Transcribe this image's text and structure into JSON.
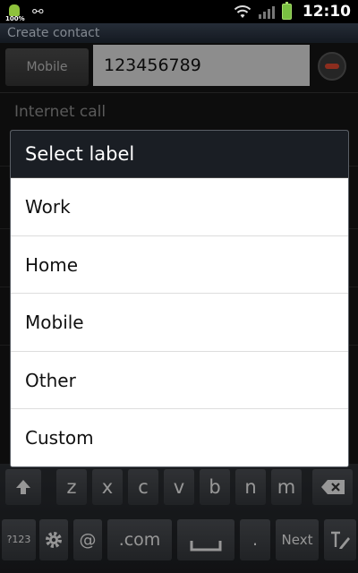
{
  "status_bar": {
    "battery_percent_small": "100%",
    "time": "12:10",
    "icons": [
      "android-icon",
      "usb-icon",
      "wifi-icon",
      "signal-icon",
      "battery-icon"
    ]
  },
  "title_bar": {
    "title": "Create contact"
  },
  "background_form": {
    "phone_label": "Mobile",
    "phone_value": "123456789",
    "section_header": "Internet call"
  },
  "dialog": {
    "title": "Select label",
    "items": [
      "Work",
      "Home",
      "Mobile",
      "Other",
      "Custom"
    ]
  },
  "keyboard": {
    "row1": [
      "z",
      "x",
      "c",
      "v",
      "b",
      "n",
      "m"
    ],
    "row2": {
      "symbols": "?123",
      "at": "@",
      "dotcom": ".com",
      "period": ".",
      "next": "Next"
    },
    "icons": [
      "shift-icon",
      "backspace-icon",
      "settings-icon",
      "space-icon",
      "handwriting-icon"
    ]
  },
  "colors": {
    "dialog_header_bg": "#1a1e24",
    "title_bar_bg": "#2b3442",
    "remove_icon": "#d8462e"
  }
}
